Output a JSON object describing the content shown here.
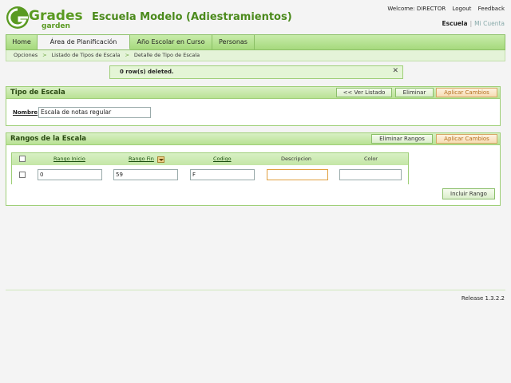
{
  "logo": {
    "text_top": "Grades",
    "text_bottom": "garden",
    "color": "#5a9a22"
  },
  "app_title": "Escuela Modelo (Adiestramientos)",
  "top_links": {
    "welcome": "Welcome: DIRECTOR",
    "logout": "Logout",
    "feedback": "Feedback"
  },
  "context": {
    "escuela": "Escuela",
    "separator": "|",
    "mi_cuenta": "Mi Cuenta"
  },
  "nav": {
    "items": [
      {
        "label": "Home"
      },
      {
        "label": "Área de Planificación"
      },
      {
        "label": "Año Escolar en Curso"
      },
      {
        "label": "Personas"
      }
    ]
  },
  "breadcrumb": {
    "items": [
      "Opciones",
      "Listado de Tipos de Escala",
      "Detalle de Tipo de Escala"
    ],
    "separator": ">"
  },
  "message": {
    "text": "0 row(s) deleted.",
    "close": "✕"
  },
  "tipo_panel": {
    "title": "Tipo de Escala",
    "btn_ver_listado": "<< Ver Listado",
    "btn_eliminar": "Eliminar",
    "btn_aplicar": "Aplicar Cambios",
    "nombre_label": "Nombre",
    "nombre_value": "Escala de notas regular"
  },
  "rangos_panel": {
    "title": "Rangos de la Escala",
    "btn_eliminar_rangos": "Eliminar Rangos",
    "btn_aplicar": "Aplicar Cambios",
    "columns": [
      "Rango Inicio",
      "Rango Fin",
      "Codigo",
      "Descripcion",
      "Color"
    ],
    "rows": [
      {
        "rango_inicio": "0",
        "rango_fin": "59",
        "codigo": "F",
        "descripcion": "",
        "color": ""
      }
    ],
    "btn_incluir": "Incluir Rango"
  },
  "footer": {
    "release": "Release 1.3.2.2"
  },
  "colors": {
    "accent_green": "#4b8a1c",
    "panel_border": "#9fcf78",
    "orange_button_text": "#b5701f"
  }
}
